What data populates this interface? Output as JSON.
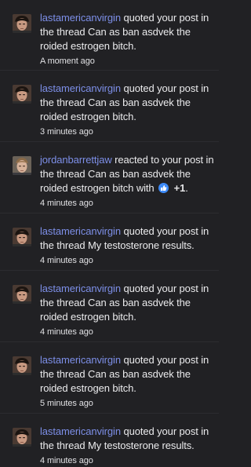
{
  "notifications": [
    {
      "user": "lastamericanvirgin",
      "text": " quoted your post in the thread Can as ban asdvek the roided estrogen bitch.",
      "time": "A moment ago",
      "avatar": "avatar-dark-hair"
    },
    {
      "user": "lastamericanvirgin",
      "text": " quoted your post in the thread Can as ban asdvek the roided estrogen bitch.",
      "time": "3 minutes ago",
      "avatar": "avatar-dark-hair"
    },
    {
      "user": "jordanbarrettjaw",
      "text": " reacted to your post in the thread Can as ban asdvek the roided estrogen bitch with",
      "reaction_icon": "like-icon",
      "reaction_suffix": " +1",
      "reaction_end": ".",
      "time": "4 minutes ago",
      "avatar": "avatar-light-hair"
    },
    {
      "user": "lastamericanvirgin",
      "text": " quoted your post in the thread My testosterone results.",
      "time": "4 minutes ago",
      "avatar": "avatar-dark-hair"
    },
    {
      "user": "lastamericanvirgin",
      "text": " quoted your post in the thread Can as ban asdvek the roided estrogen bitch.",
      "time": "4 minutes ago",
      "avatar": "avatar-dark-hair"
    },
    {
      "user": "lastamericanvirgin",
      "text": " quoted your post in the thread Can as ban asdvek the roided estrogen bitch.",
      "time": "5 minutes ago",
      "avatar": "avatar-dark-hair"
    },
    {
      "user": "lastamericanvirgin",
      "text": " quoted your post in the thread My testosterone results.",
      "time": "4 minutes ago",
      "avatar": "avatar-dark-hair"
    }
  ],
  "colors": {
    "background": "#212124",
    "username": "#7d8fe8",
    "like": "#3d8af7"
  }
}
